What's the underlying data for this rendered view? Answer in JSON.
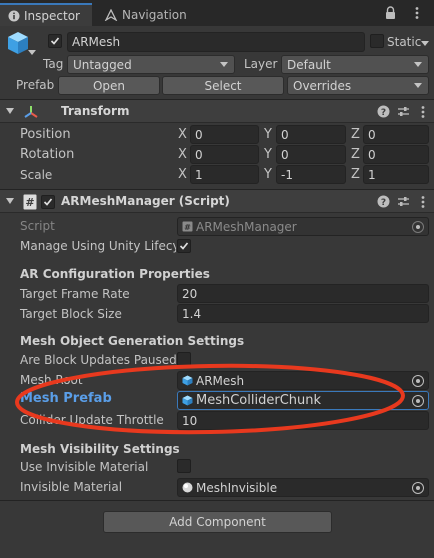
{
  "tabs": [
    {
      "label": "Inspector"
    },
    {
      "label": "Navigation"
    }
  ],
  "object": {
    "name": "ARMesh",
    "static_label": "Static",
    "tag_label": "Tag",
    "tag_value": "Untagged",
    "layer_label": "Layer",
    "layer_value": "Default",
    "prefab_label": "Prefab",
    "open_label": "Open",
    "select_label": "Select",
    "overrides_label": "Overrides"
  },
  "transform": {
    "title": "Transform",
    "rows": [
      {
        "label": "Position",
        "x": "0",
        "y": "0",
        "z": "0"
      },
      {
        "label": "Rotation",
        "x": "0",
        "y": "0",
        "z": "0"
      },
      {
        "label": "Scale",
        "x": "1",
        "y": "-1",
        "z": "1"
      }
    ],
    "axis_x": "X",
    "axis_y": "Y",
    "axis_z": "Z"
  },
  "component": {
    "title": "ARMeshManager (Script)",
    "script_label": "Script",
    "script_value": "ARMeshManager",
    "manage_label": "Manage Using Unity Lifecyc",
    "ar_config_header": "AR Configuration Properties",
    "frame_rate_label": "Target Frame Rate",
    "frame_rate_value": "20",
    "block_size_label": "Target Block Size",
    "block_size_value": "1.4",
    "mesh_gen_header": "Mesh Object Generation Settings",
    "paused_label": "Are Block Updates Paused",
    "mesh_root_label": "Mesh Root",
    "mesh_root_value": "ARMesh",
    "mesh_prefab_label": "Mesh Prefab",
    "mesh_prefab_value": "MeshColliderChunk",
    "collider_label": "Collider Update Throttle",
    "collider_value": "10",
    "visibility_header": "Mesh Visibility Settings",
    "invisible_use_label": "Use Invisible Material",
    "invisible_mat_label": "Invisible Material",
    "invisible_mat_value": "MeshInvisible"
  },
  "add_component_label": "Add Component",
  "colors": {
    "annotation": "#e8391e",
    "highlight_label": "#5a9ee8",
    "accent": "#3a79bb"
  }
}
